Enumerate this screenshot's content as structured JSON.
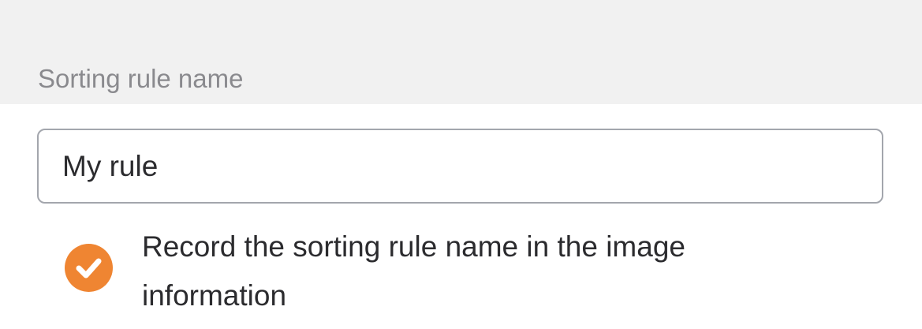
{
  "section": {
    "label": "Sorting rule name"
  },
  "rule_name_input": {
    "value": "My rule",
    "placeholder": ""
  },
  "record_option": {
    "checked": true,
    "label": "Record the sorting rule name in the image information",
    "check_icon": "checkmark-icon"
  },
  "colors": {
    "accent": "#ef8532",
    "section_background": "#f1f1f1",
    "label_text": "#8a8a8e",
    "input_border": "#a3a6ad",
    "body_text": "#2b2b2e"
  }
}
